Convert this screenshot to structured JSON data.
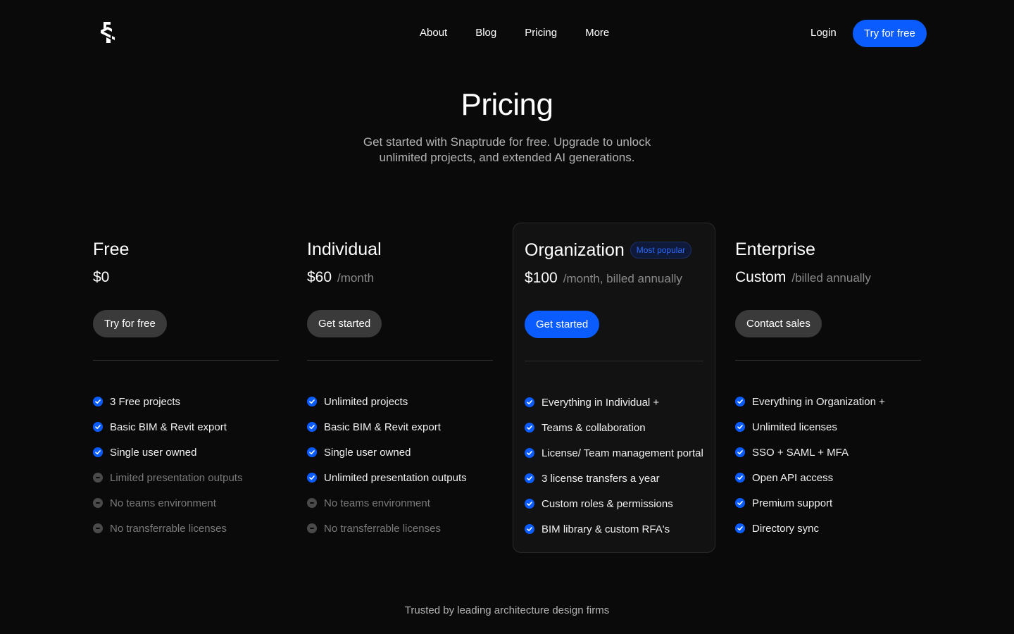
{
  "header": {
    "nav": [
      {
        "label": "About"
      },
      {
        "label": "Blog"
      },
      {
        "label": "Pricing"
      },
      {
        "label": "More"
      }
    ],
    "login_label": "Login",
    "cta_label": "Try for free"
  },
  "hero": {
    "title": "Pricing",
    "subtitle": "Get started with Snaptrude for free. Upgrade to unlock unlimited projects, and extended AI generations."
  },
  "plans": [
    {
      "name": "Free",
      "badge": "",
      "price": "$0",
      "period": "",
      "cta": "Try for free",
      "features": [
        {
          "text": "3 Free projects",
          "included": true
        },
        {
          "text": "Basic BIM & Revit export",
          "included": true
        },
        {
          "text": "Single user owned",
          "included": true
        },
        {
          "text": "Limited presentation outputs",
          "included": false
        },
        {
          "text": "No teams environment",
          "included": false
        },
        {
          "text": "No transferrable licenses",
          "included": false
        }
      ]
    },
    {
      "name": "Individual",
      "badge": "",
      "price": "$60",
      "period": "/month",
      "cta": "Get started",
      "features": [
        {
          "text": "Unlimited projects",
          "included": true
        },
        {
          "text": "Basic BIM & Revit export",
          "included": true
        },
        {
          "text": "Single user owned",
          "included": true
        },
        {
          "text": "Unlimited presentation outputs",
          "included": true
        },
        {
          "text": "No teams environment",
          "included": false
        },
        {
          "text": "No transferrable licenses",
          "included": false
        }
      ]
    },
    {
      "name": "Organization",
      "badge": "Most popular",
      "price": "$100",
      "period": "/month, billed annually",
      "cta": "Get started",
      "features": [
        {
          "text": "Everything in Individual +",
          "included": true
        },
        {
          "text": "Teams & collaboration",
          "included": true
        },
        {
          "text": "License/ Team management portal",
          "included": true
        },
        {
          "text": "3 license transfers a year",
          "included": true
        },
        {
          "text": "Custom roles & permissions",
          "included": true
        },
        {
          "text": "BIM library & custom RFA's",
          "included": true
        }
      ]
    },
    {
      "name": "Enterprise",
      "badge": "",
      "price": "Custom",
      "period": "/billed annually",
      "cta": "Contact sales",
      "features": [
        {
          "text": "Everything in Organization +",
          "included": true
        },
        {
          "text": "Unlimited licenses",
          "included": true
        },
        {
          "text": "SSO + SAML + MFA",
          "included": true
        },
        {
          "text": "Open API access",
          "included": true
        },
        {
          "text": "Premium support",
          "included": true
        },
        {
          "text": "Directory sync",
          "included": true
        }
      ]
    }
  ],
  "trusted": "Trusted by leading architecture design firms",
  "colors": {
    "background": "#0a0a0a",
    "accent": "#0a5cff",
    "muted_button": "#3a3a3a"
  }
}
